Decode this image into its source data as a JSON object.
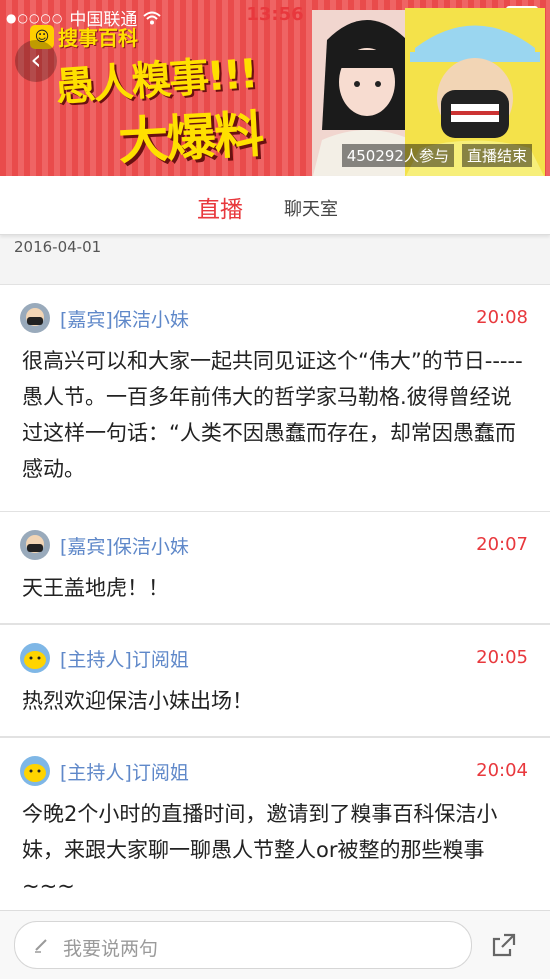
{
  "status": {
    "carrier": "中国联通",
    "time": "13:56"
  },
  "banner": {
    "logo": "搜事百科",
    "title_line1": "愚人糗事!!!",
    "title_line2": "大爆料",
    "participants": "450292人参与",
    "live_status": "直播结束"
  },
  "tabs": {
    "live": "直播",
    "chat": "聊天室"
  },
  "date": "2016-04-01",
  "messages": [
    {
      "name": "[嘉宾]保洁小妹",
      "time": "20:08",
      "text": "很高兴可以和大家一起共同见证这个“伟大”的节日-----愚人节。一百多年前伟大的哲学家马勒格.彼得曾经说过这样一句话：“人类不因愚蠢而存在，却常因愚蠢而感动。"
    },
    {
      "name": "[嘉宾]保洁小妹",
      "time": "20:07",
      "text": "天王盖地虎！！"
    },
    {
      "name": "[主持人]订阅姐",
      "time": "20:05",
      "text": "热烈欢迎保洁小妹出场！"
    },
    {
      "name": "[主持人]订阅姐",
      "time": "20:04",
      "text": "今晚2个小时的直播时间，邀请到了糗事百科保洁小妹，来跟大家聊一聊愚人节整人or被整的那些糗事~~~"
    }
  ],
  "input": {
    "placeholder": "我要说两句"
  },
  "colors": {
    "accent": "#e8383d",
    "name": "#5f88c9",
    "banner": "#e94b4b"
  }
}
